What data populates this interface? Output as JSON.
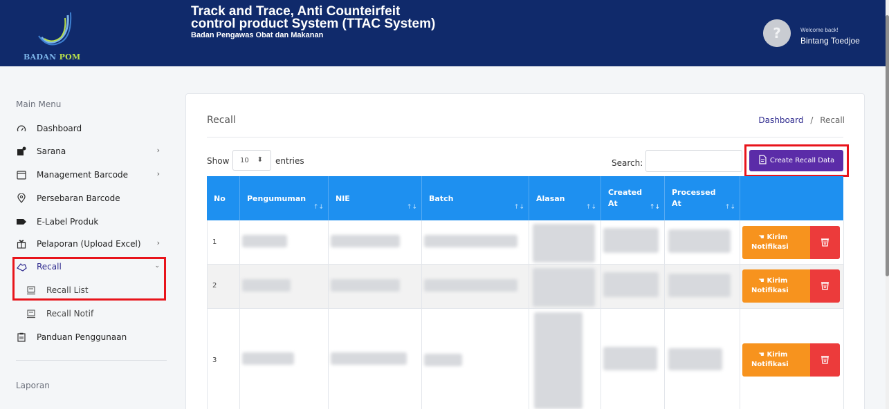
{
  "header": {
    "logo_text_1": "BADAN ",
    "logo_text_2": "POM",
    "title_line1": "Track and Trace, Anti Counteirfeit",
    "title_line2": "control product System (TTAC System)",
    "subtitle": "Badan Pengawas Obat dan Makanan",
    "welcome": "Welcome back!",
    "username": "Bintang Toedjoe"
  },
  "sidebar": {
    "main_menu_heading": "Main Menu",
    "items": [
      {
        "label": "Dashboard",
        "icon": "speedometer-icon"
      },
      {
        "label": "Sarana",
        "icon": "user-add-icon"
      },
      {
        "label": "Management Barcode",
        "icon": "window-icon"
      },
      {
        "label": "Persebaran Barcode",
        "icon": "location-pin-icon"
      },
      {
        "label": "E-Label Produk",
        "icon": "label-icon"
      },
      {
        "label": "Pelaporan (Upload Excel)",
        "icon": "gift-icon"
      },
      {
        "label": "Recall",
        "icon": "recall-hand-icon"
      },
      {
        "label": "Recall List",
        "icon": "monitor-icon"
      },
      {
        "label": "Recall Notif",
        "icon": "monitor-icon"
      },
      {
        "label": "Panduan Penggunaan",
        "icon": "clipboard-icon"
      }
    ],
    "laporan_heading": "Laporan"
  },
  "page": {
    "title": "Recall",
    "breadcrumb_link": "Dashboard",
    "breadcrumb_sep": "/",
    "breadcrumb_current": "Recall",
    "show_label": "Show",
    "entries_value": "10",
    "entries_label": "entries",
    "search_label": "Search:",
    "search_value": "",
    "create_button": "Create Recall Data"
  },
  "table": {
    "columns": [
      "No",
      "Pengumuman",
      "NIE",
      "Batch",
      "Alasan",
      "Created At",
      "Processed At",
      ""
    ],
    "rows": [
      {
        "no": "1"
      },
      {
        "no": "2"
      },
      {
        "no": "3"
      }
    ],
    "action_label_1": "Kirim",
    "action_label_2": "Notifikasi"
  },
  "colors": {
    "header_bg": "#102a6b",
    "accent": "#5b2ca8",
    "table_head": "#1e90f0",
    "action_orange": "#f7931e",
    "action_red": "#ec3b3b",
    "highlight": "#e8141b"
  }
}
